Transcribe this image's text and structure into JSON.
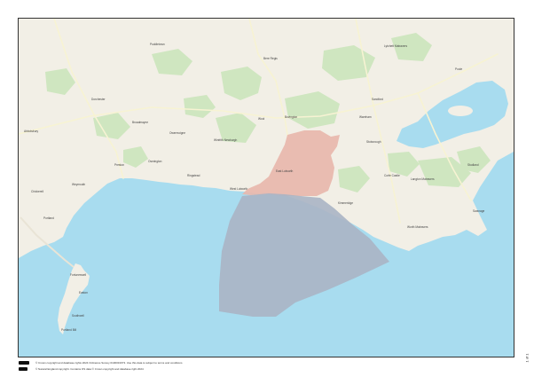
{
  "map": {
    "colors": {
      "sea": "#a8dcef",
      "land": "#f2efe6",
      "woodland": "#cfe6c0",
      "site_boundary": "#e8b7ad",
      "offshore_area": "#aab4c4",
      "road": "#f7f3d3"
    },
    "labels": {
      "poole": "Poole",
      "lytchett_matravers": "Lytchett Matravers",
      "dorchester": "Dorchester",
      "wareham": "Wareham",
      "bovington": "Bovington",
      "east_lulworth": "East Lulworth",
      "west_lulworth": "West Lulworth",
      "kimmeridge": "Kimmeridge",
      "corfe_castle": "Corfe Castle",
      "studland": "Studland",
      "swanage": "Swanage",
      "worth_matravers": "Worth Matravers",
      "langton_matravers": "Langton Matravers",
      "weymouth": "Weymouth",
      "portland": "Portland",
      "fortuneswell": "Fortuneswell",
      "easton": "Easton",
      "southwell": "Southwell",
      "portland_bill": "Portland Bill",
      "broadmayne": "Broadmayne",
      "owermoigne": "Owermoigne",
      "osmington": "Osmington",
      "preston": "Preston",
      "chickerell": "Chickerell",
      "abbotsbury": "Abbotsbury",
      "wool": "Wool",
      "bere_regis": "Bere Regis",
      "puddletown": "Puddletown",
      "sandford": "Sandford",
      "stoborough": "Stoborough",
      "ringstead": "Ringstead",
      "winfrith_newburgh": "Winfrith Newburgh"
    }
  },
  "footer": {
    "copyright_line": "© Crown copyright and database rights 2024 Ordnance Survey 0100031673. Use this data is subject to terms and conditions",
    "attribution_line": "© Natural England copyright. Contains OS data © Crown copyright and database right 2024"
  },
  "page_marker": "1 of 1"
}
